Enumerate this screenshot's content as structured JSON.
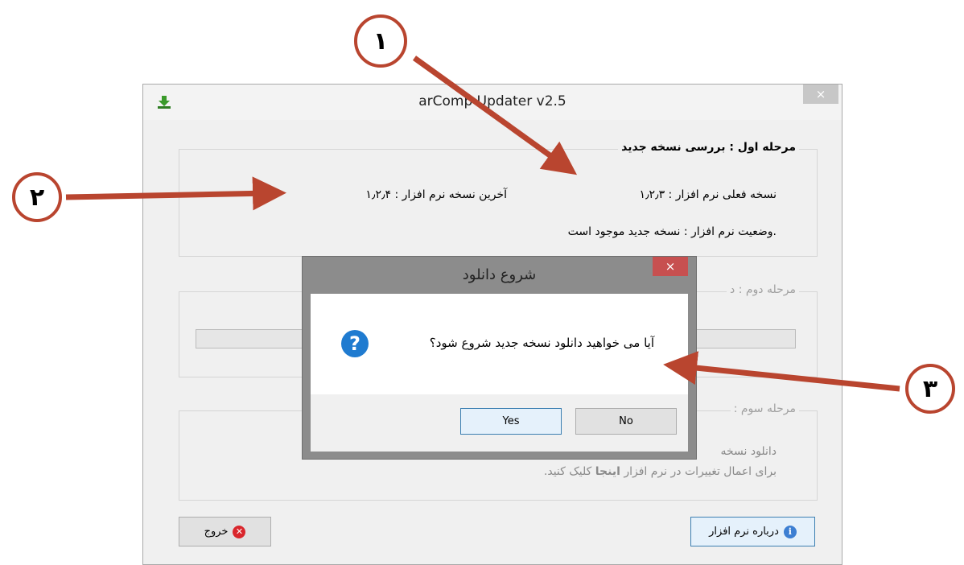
{
  "window": {
    "title": "arComp Updater v2.5",
    "close": "×",
    "step1": {
      "title": "مرحله اول : بررسی نسخه جدید",
      "current_version": "نسخه فعلی نرم افزار : ۱٫۲٫۳",
      "latest_version": "آخرین نسخه نرم افزار : ۱٫۲٫۴",
      "status": ".وضعیت نرم افزار : نسخه جدید موجود است"
    },
    "step2": {
      "title_partial": "مرحله دوم : د"
    },
    "step3": {
      "title_partial": "مرحله سوم :",
      "line1_partial": "دانلود نسخه",
      "line2_prefix": "برای اعمال تغییرات در نرم افزار",
      "line2_link": "اینجا",
      "line2_suffix": "کلیک کنید."
    },
    "exit_button": "خروج",
    "about_button": "درباره نرم افزار"
  },
  "dialog": {
    "title": "شروع دانلود",
    "close": "×",
    "icon": "question-icon",
    "message": "آیا می خواهید دانلود نسخه جدید شروع شود؟",
    "yes": "Yes",
    "no": "No"
  },
  "annotations": {
    "badge1": "۱",
    "badge2": "۲",
    "badge3": "۳",
    "color": "#b9452f"
  }
}
